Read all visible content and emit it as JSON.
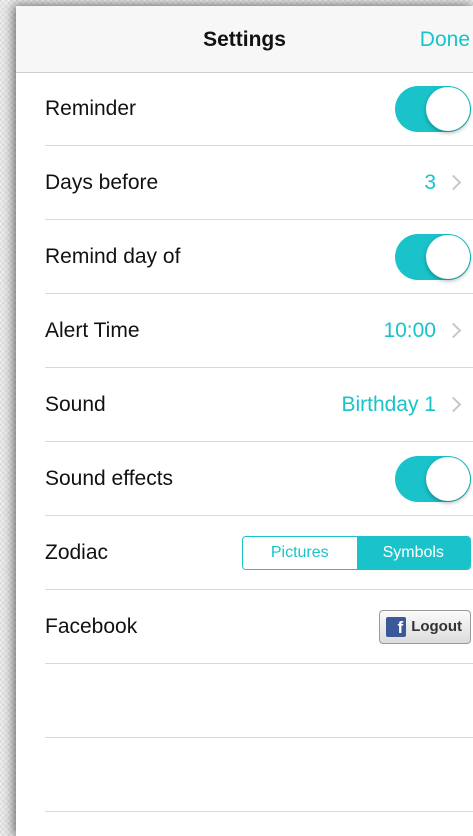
{
  "navbar": {
    "title": "Settings",
    "done_label": "Done"
  },
  "rows": {
    "reminder": {
      "label": "Reminder",
      "toggle_on": true
    },
    "days_before": {
      "label": "Days before",
      "value": "3"
    },
    "remind_day_of": {
      "label": "Remind day of",
      "toggle_on": true
    },
    "alert_time": {
      "label": "Alert Time",
      "value": "10:00"
    },
    "sound": {
      "label": "Sound",
      "value": "Birthday 1"
    },
    "sound_effects": {
      "label": "Sound effects",
      "toggle_on": true
    },
    "zodiac": {
      "label": "Zodiac",
      "options": [
        "Pictures",
        "Symbols"
      ],
      "selected": "Symbols"
    },
    "facebook": {
      "label": "Facebook",
      "button_label": "Logout",
      "icon": "facebook-icon"
    }
  },
  "colors": {
    "accent": "#19c3c9",
    "facebook_blue": "#3b5998"
  },
  "icons": {
    "chevron": "chevron-right-icon",
    "facebook": "facebook-icon"
  }
}
